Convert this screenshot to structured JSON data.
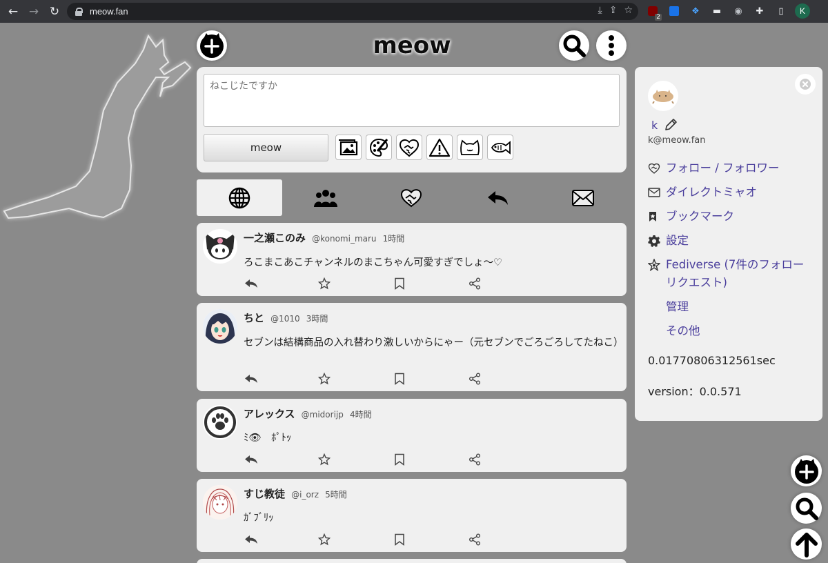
{
  "browser": {
    "url": "meow.fan",
    "profile_initial": "K",
    "extension_badge": "2"
  },
  "header": {
    "logo_text": "meow"
  },
  "composer": {
    "placeholder": "ねこじたですか",
    "submit_label": "meow",
    "tools": [
      "image-icon",
      "paint-palette-icon",
      "handshake-icon",
      "warning-icon",
      "cat-face-icon",
      "fish-icon"
    ]
  },
  "tabs": [
    {
      "icon": "globe-icon",
      "active": true
    },
    {
      "icon": "group-icon",
      "active": false
    },
    {
      "icon": "handshake-icon",
      "active": false
    },
    {
      "icon": "reply-icon",
      "active": false
    },
    {
      "icon": "envelope-icon",
      "active": false
    }
  ],
  "posts": [
    {
      "name": "一之瀬このみ",
      "handle": "@konomi_maru",
      "time": "1時間",
      "text": "ろこまこあこチャンネルのまこちゃん可愛すぎでしょ～♡"
    },
    {
      "name": "ちと",
      "handle": "@1010",
      "time": "3時間",
      "text": "セブンは結構商品の入れ替わり激しいからにゃー（元セブンでごろごろしてたねこ）"
    },
    {
      "name": "アレックス",
      "handle": "@midorijp",
      "time": "4時間",
      "text": "ﾐ👁　ﾎﾟﾄｯ"
    },
    {
      "name": "すじ教徒",
      "handle": "@i_orz",
      "time": "5時間",
      "text": "ｶﾞﾌﾞﾘｯ"
    }
  ],
  "sidebar": {
    "user_name": "k",
    "account": "k@meow.fan",
    "menu": [
      {
        "icon": "handshake-icon",
        "label": "フォロー / フォロワー"
      },
      {
        "icon": "envelope-icon",
        "label": "ダイレクトミャオ"
      },
      {
        "icon": "bookmark-icon",
        "label": "ブックマーク"
      },
      {
        "icon": "gear-icon",
        "label": "設定"
      },
      {
        "icon": "fediverse-icon",
        "label": "Fediverse (7件のフォローリクエスト)"
      },
      {
        "icon": "",
        "label": "管理"
      },
      {
        "icon": "",
        "label": "その他"
      }
    ],
    "render_time": "0.01770806312561sec",
    "version": "version：0.0.571"
  },
  "colors": {
    "page_bg": "#8a8a8a",
    "card_bg": "#f0f0f0",
    "link": "#4a3e9c",
    "chrome_bg": "#35363a"
  }
}
